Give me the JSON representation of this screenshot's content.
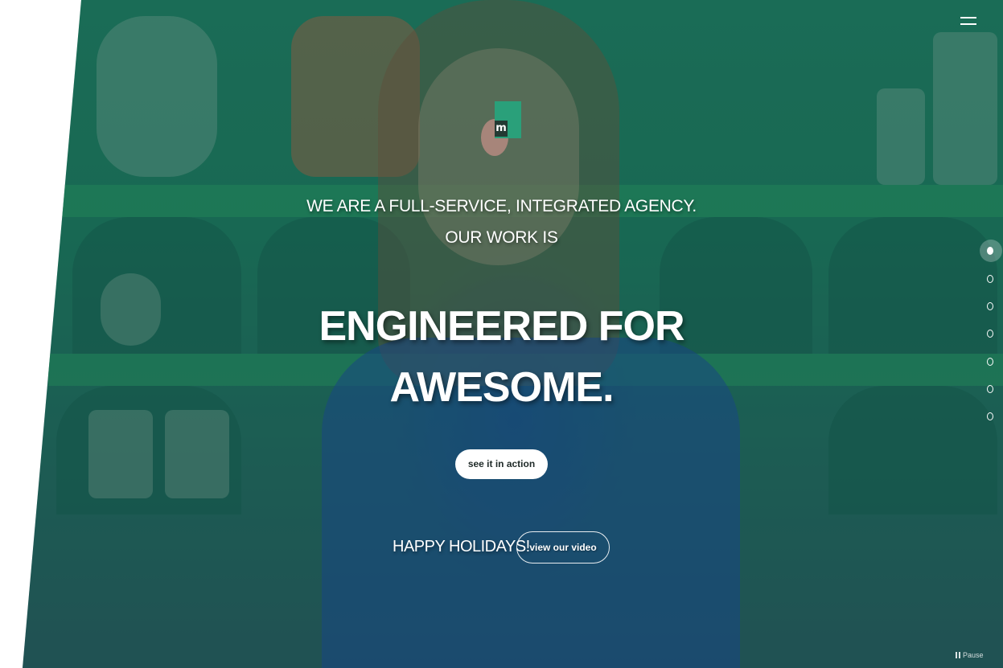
{
  "logo": {
    "letter": "m"
  },
  "hero": {
    "tagline_line1": "WE ARE A FULL-SERVICE, INTEGRATED AGENCY.",
    "tagline_line2": "OUR WORK IS",
    "headline_line1": "ENGINEERED FOR",
    "headline_line2": "AWESOME.",
    "cta_label": "see it in action",
    "holiday_text": "HAPPY HOLIDAYS!",
    "video_label": "view our video"
  },
  "slider": {
    "total_dots": 7,
    "active_index": 0
  },
  "controls": {
    "pause_label": "Pause"
  },
  "colors": {
    "accent_green": "#2aa07a",
    "overlay_green": "#1d6f58",
    "logo_circle": "#b58a80"
  },
  "icons": {
    "menu": "hamburger-menu-icon",
    "pause": "pause-icon"
  }
}
